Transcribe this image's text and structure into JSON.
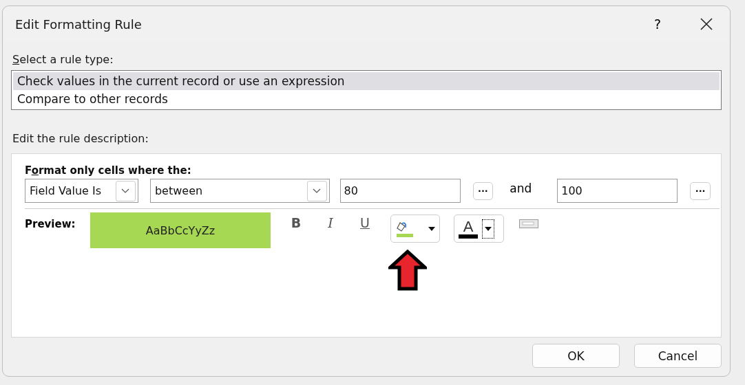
{
  "window": {
    "title": "Edit Formatting Rule",
    "help": "?"
  },
  "rule_type": {
    "label": {
      "mnemonic": "S",
      "after": "elect a rule type:"
    },
    "items": [
      {
        "label": "Check values in the current record or use an expression",
        "selected": true
      },
      {
        "label": "Compare to other records",
        "selected": false
      }
    ]
  },
  "description": {
    "label": "Edit the rule description:",
    "heading": {
      "before": "F",
      "mnemonic": "o",
      "after": "rmat only cells where the:"
    },
    "field_combo": {
      "value": "Field Value Is"
    },
    "operator_combo": {
      "value": "between"
    },
    "value_1": {
      "value": "80",
      "builder": "..."
    },
    "joiner": "and",
    "value_2": {
      "value": "100",
      "builder": "..."
    },
    "preview": {
      "label": "Preview:",
      "sample": "AaBbCcYyZz"
    },
    "format_buttons": [
      {
        "kind": "bold",
        "label": "B"
      },
      {
        "kind": "italic",
        "label": "I"
      },
      {
        "kind": "underline",
        "label": "U"
      }
    ],
    "font_color": {
      "label": "A"
    }
  },
  "buttons": [
    {
      "label": "OK"
    },
    {
      "label": "Cancel"
    }
  ]
}
